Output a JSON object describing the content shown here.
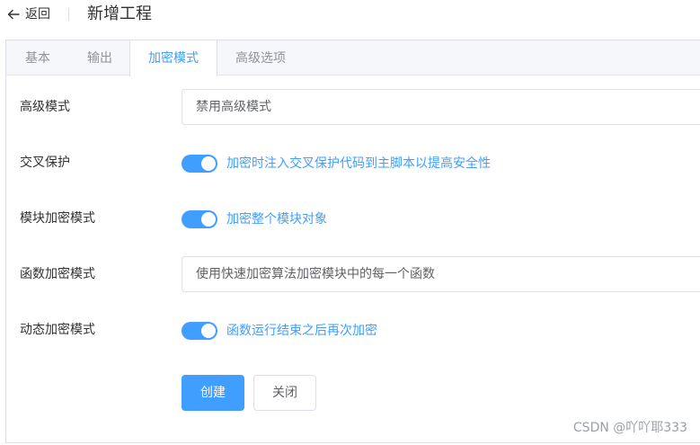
{
  "header": {
    "back_label": "返回",
    "title": "新增工程"
  },
  "tabs": [
    {
      "label": "基本"
    },
    {
      "label": "输出"
    },
    {
      "label": "加密模式",
      "active": true
    },
    {
      "label": "高级选项"
    }
  ],
  "form": {
    "advanced_mode": {
      "label": "高级模式",
      "value": "禁用高级模式"
    },
    "cross_protect": {
      "label": "交叉保护",
      "enabled": true,
      "text": "加密时注入交叉保护代码到主脚本以提高安全性"
    },
    "module_mode": {
      "label": "模块加密模式",
      "enabled": true,
      "text": "加密整个模块对象"
    },
    "function_mode": {
      "label": "函数加密模式",
      "value": "使用快速加密算法加密模块中的每一个函数"
    },
    "dynamic_mode": {
      "label": "动态加密模式",
      "enabled": true,
      "text": "函数运行结束之后再次加密"
    }
  },
  "buttons": {
    "create": "创建",
    "close": "关闭"
  },
  "watermark": "CSDN @吖吖耶333",
  "colors": {
    "primary": "#409eff",
    "border": "#dcdfe6",
    "tab_bg": "#f5f7fa",
    "text": "#303133"
  }
}
